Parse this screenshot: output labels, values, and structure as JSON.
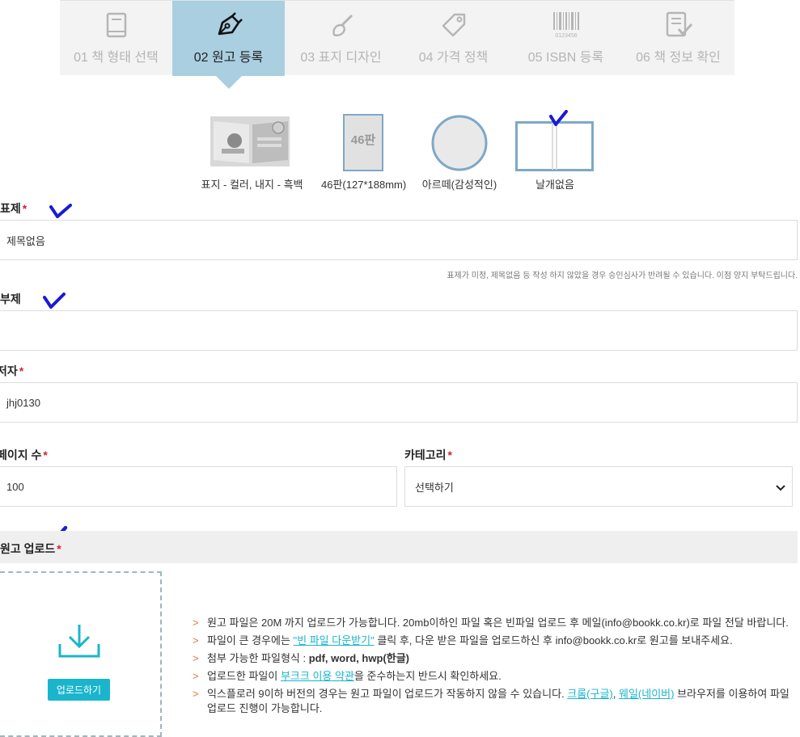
{
  "steps": [
    {
      "label": "01 책 형태 선택",
      "icon": "book-icon",
      "active": false
    },
    {
      "label": "02 원고 등록",
      "icon": "pen-nib-icon",
      "active": true
    },
    {
      "label": "03 표지 디자인",
      "icon": "brush-icon",
      "active": false
    },
    {
      "label": "04 가격 정책",
      "icon": "price-tag-icon",
      "active": false
    },
    {
      "label": "05 ISBN 등록",
      "icon": "barcode-icon",
      "active": false
    },
    {
      "label": "06 책 정보 확인",
      "icon": "checklist-icon",
      "active": false
    }
  ],
  "barcode_number": "0123456",
  "options": {
    "color_type": "표지 - 컬러, 내지 - 흑백",
    "size": "46판(127*188mm)",
    "size_badge": "46판",
    "finish": "아르떼(감성적인)",
    "wing": "날개없음"
  },
  "form": {
    "title_label": "표제",
    "title_value": "제목없음",
    "title_note": "표제가 미정, 제목없음 등 작성 하지 않았을 경우 승인심사가 반려될 수 있습니다. 이점 양지 부탁드립니다.",
    "subtitle_label": "부제",
    "subtitle_value": "",
    "author_label": "저자",
    "author_value": "jhj0130",
    "pages_label": "페이지 수",
    "pages_value": "100",
    "category_label": "카테고리",
    "category_value": "선택하기",
    "required_mark": "*"
  },
  "upload": {
    "section_label": "원고 업로드",
    "button_label": "업로드하기",
    "info": [
      {
        "text": "원고 파일은 20M 까지 업로드가 가능합니다. 20mb이하인 파일 혹은 빈파일 업로드 후 메일(info@bookk.co.kr)로 파일 전달 바랍니다."
      },
      {
        "pre": "파일이 큰 경우에는 ",
        "link": "\"빈 파일 다운받기\"",
        "post": " 클릭 후, 다운 받은 파일을 업로드하신 후 info@bookk.co.kr로 원고를 보내주세요."
      },
      {
        "pre": "첨부 가능한 파일형식 : ",
        "bold": "pdf, word, hwp(한글)"
      },
      {
        "pre": "업로드한 파일이 ",
        "link": "부크크 이용 약관",
        "post": "을 준수하는지 반드시 확인하세요."
      },
      {
        "pre": "익스플로러 9이하 버전의 경우는 원고 파일이 업로드가 작동하지 않을 수 있습니다. ",
        "link": "크롬(구글)",
        "mid": ", ",
        "link2": "웨일(네이버)",
        "post": " 브라우저를 이용하여 파일 업로드 진행이 가능합니다."
      }
    ]
  },
  "colors": {
    "accent": "#1ab5cc",
    "active_step": "#a9cfe0",
    "required": "#d9202e",
    "bullet": "#e8743b",
    "check_mark": "#1a1ad6"
  }
}
